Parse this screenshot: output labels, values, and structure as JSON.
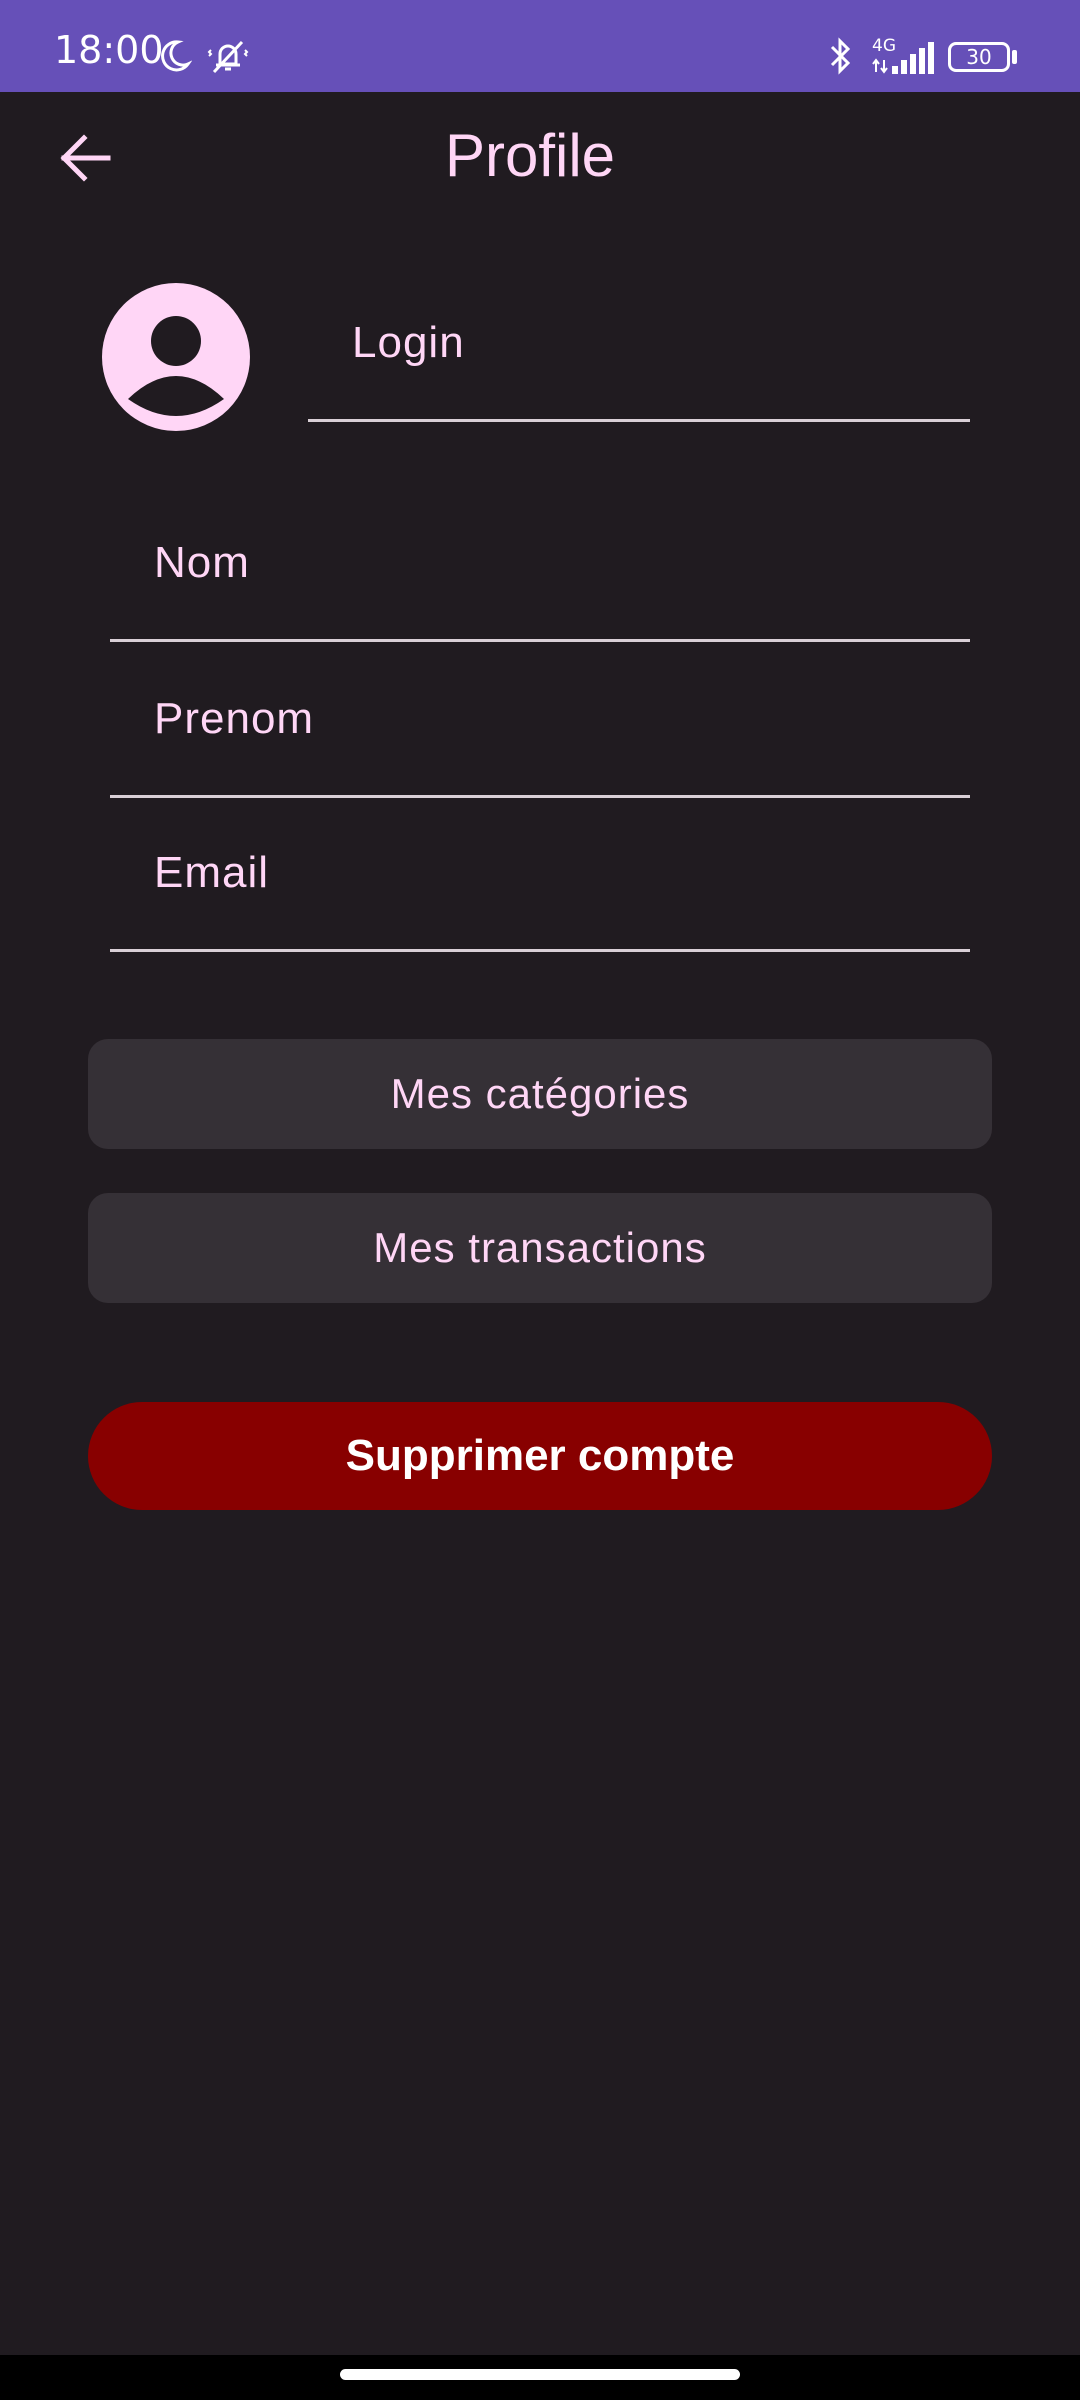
{
  "status_bar": {
    "time": "18:00",
    "network": "4G",
    "battery": "30",
    "icons": [
      "moon-icon",
      "notifications-off-icon",
      "bluetooth-icon",
      "signal-icon",
      "battery-icon"
    ]
  },
  "header": {
    "title": "Profile",
    "back_icon": "arrow-back-icon"
  },
  "profile": {
    "avatar_icon": "account-circle-icon",
    "login_label": "Login"
  },
  "form": {
    "nom_label": "Nom",
    "prenom_label": "Prenom",
    "email_label": "Email"
  },
  "actions": {
    "categories_label": "Mes catégories",
    "transactions_label": "Mes transactions",
    "delete_label": "Supprimer compte"
  },
  "colors": {
    "status_bar": "#6650b8",
    "background": "#201b20",
    "accent_text": "#ffd6f6",
    "button_bg": "#353036",
    "danger": "#880000"
  }
}
